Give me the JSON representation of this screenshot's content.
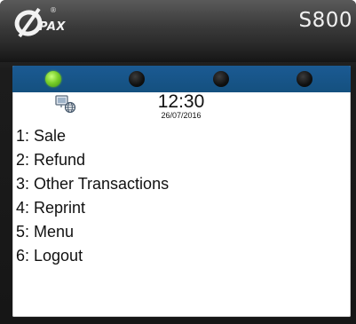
{
  "device": {
    "brand": "PAX",
    "brand_mark": "®",
    "model": "S800"
  },
  "status": {
    "leds": [
      {
        "state": "on",
        "color": "#7bd02b"
      },
      {
        "state": "off",
        "color": "#101010"
      },
      {
        "state": "off",
        "color": "#101010"
      },
      {
        "state": "off",
        "color": "#101010"
      }
    ],
    "network_icon": "network-globe-icon",
    "time": "12:30",
    "date": "26/07/2016"
  },
  "menu": {
    "items": [
      {
        "label": "1: Sale"
      },
      {
        "label": "2: Refund"
      },
      {
        "label": "3: Other Transactions"
      },
      {
        "label": "4: Reprint"
      },
      {
        "label": "5: Menu"
      },
      {
        "label": "6: Logout"
      }
    ]
  },
  "colors": {
    "status_bar": "#1b5a93",
    "screen_background": "#ffffff",
    "text": "#111111"
  }
}
